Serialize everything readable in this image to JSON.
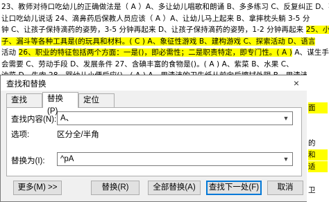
{
  "document": {
    "lines": [
      {
        "segments": [
          {
            "text": "23、教师对待口吃幼儿的正确做法是（ A ）A、多让幼儿唱歌和朗诵    B、多多练习      C、反复纠正      D、不",
            "hl": false
          }
        ]
      },
      {
        "segments": [
          {
            "text": "让口吃幼儿说话   24、滴鼻药后保教人员应该（ A ）A、让幼儿马上起来          B、拿摔枕头躺 3-5 分",
            "hl": false
          }
        ]
      },
      {
        "segments": [
          {
            "text": "钟 C、让孩子保持滴药的姿势，3-5 分钟再起来      D、让孩子保持滴药的姿势，1-2 分钟再起来  ",
            "hl": false
          },
          {
            "text": "25、小勺、小钳",
            "hl": true
          }
        ]
      },
      {
        "segments": [
          {
            "text": "子、漏斗等各种工具是(的玩具和材料。( C ) A、象征性游戏      B、建构游戏      C、探索活动      D、语言",
            "hl": true
          }
        ]
      },
      {
        "segments": [
          {
            "text": "活动 ",
            "hl": false
          },
          {
            "text": "26、职业的特征包括两个方面：一是()，即必需性；二是职责特定，即专门性。( A )",
            "hl": true
          },
          {
            "text": " A、谋生手段      B、社",
            "hl": false
          }
        ]
      },
      {
        "segments": [
          {
            "text": "会需要          C、劳动手段        D、发展条件 27、含碘丰富的食物是()。( A ) A、紫菜        B、水果        C、",
            "hl": false
          }
        ]
      },
      {
        "segments": [
          {
            "text": "油菜          D、牛肉  28、婴幼儿小便后应()。( A ) A、用清洁的卫生纸从前向后擦拭外阴  B、用清洁的卫",
            "hl": false
          }
        ]
      },
      {
        "segments": [
          {
            "text": "生纸从后向前擦拭外阴  C、不擦外阴    D、用任何纸擦拭外阴  29、幼儿与成人的关系主要体现在亲子关系和()。",
            "hl": false
          }
        ]
      }
    ],
    "right_strip": [
      {
        "text": "面",
        "hl": true
      },
      {
        "text": "",
        "hl": false
      },
      {
        "text": "",
        "hl": false
      },
      {
        "text": "的",
        "hl": false
      },
      {
        "text": "和",
        "hl": true
      },
      {
        "text": "适",
        "hl": true
      },
      {
        "text": "",
        "hl": false
      },
      {
        "text": "卫",
        "hl": false
      }
    ]
  },
  "dialog": {
    "title": "查找和替换",
    "close_icon": "×",
    "tabs": [
      {
        "label": "查找(D)",
        "active": false
      },
      {
        "label": "替换(P)",
        "active": true
      },
      {
        "label": "定位(G)",
        "active": false
      }
    ],
    "find_label": "查找内容(N):",
    "find_value": "A、",
    "options_label": "选项:",
    "options_value": "区分全/半角",
    "replace_label": "替换为(I):",
    "replace_value": "^pA",
    "buttons": {
      "more": "更多(M) >>",
      "replace": "替换(R)",
      "replace_all": "全部替换(A)",
      "find_next": "查找下一处(F)",
      "cancel": "取消"
    }
  }
}
